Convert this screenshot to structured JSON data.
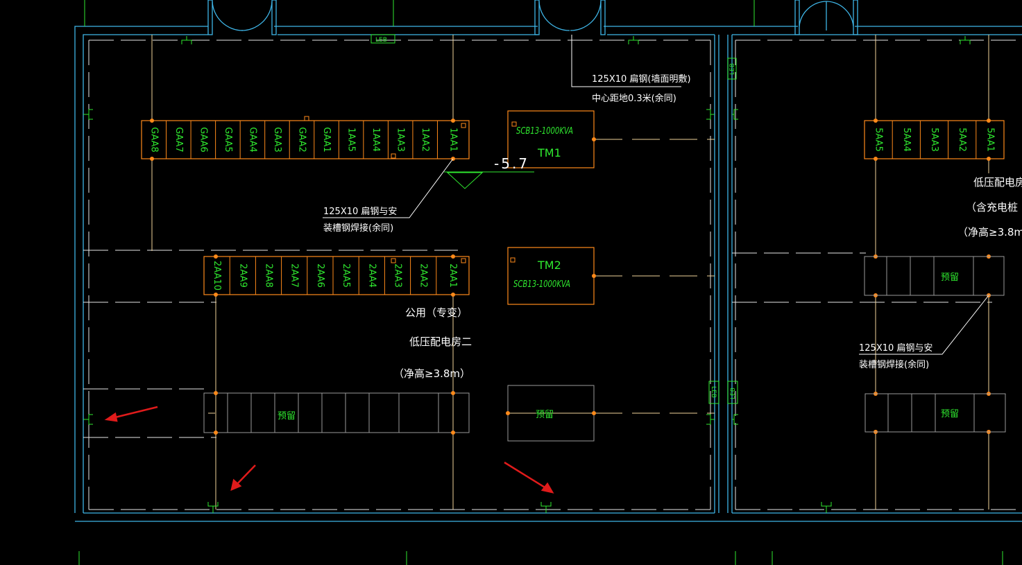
{
  "colors": {
    "background": "#000000",
    "wall": "#3fb6e8",
    "panel": "#ff8a1a",
    "green_text": "#2fe82f",
    "white_text": "#ffffff",
    "line": "#f2d39a",
    "gray": "#9a9a9a",
    "arrow": "#e01b1b"
  },
  "labels": {
    "leb": "LEB",
    "reserved": "预留",
    "elevation": "-5.7"
  },
  "rows": {
    "row1_cells": [
      "GAA8",
      "GAA7",
      "GAA6",
      "GAA5",
      "GAA4",
      "GAA3",
      "GAA2",
      "GAA1",
      "1AA5",
      "1AA4",
      "1AA3",
      "1AA2",
      "1AA1"
    ],
    "row2_cells": [
      "2AA10",
      "2AA9",
      "2AA8",
      "2AA7",
      "2AA6",
      "2AA5",
      "2AA4",
      "2AA3",
      "2AA2",
      "2AA1"
    ],
    "right_row_cells": [
      "5AA5",
      "5AA4",
      "5AA3",
      "5AA2",
      "5AA1"
    ]
  },
  "transformers": {
    "tm1_model": "SCB13-1000KVA",
    "tm1_name": "TM1",
    "tm2_name": "TM2",
    "tm2_model": "SCB13-1000KVA"
  },
  "notes": {
    "flat_steel_wall_1": "125X10 扁钢(墙面明敷)",
    "flat_steel_wall_2": "中心距地0.3米(余同)",
    "flat_steel_weld_1": "125X10 扁钢与安",
    "flat_steel_weld_2": "装槽钢焊接(余同)",
    "room_public": "公用（专变）",
    "room_name": "低压配电房二",
    "room_height": "（净高≥3.8m）",
    "right_room_name": "低压配电房",
    "right_room_sub": "（含充电桩",
    "right_room_height": "（净高≥3.8m",
    "right_weld_1": "125X10 扁钢与安",
    "right_weld_2": "装槽钢焊接(余同)"
  }
}
